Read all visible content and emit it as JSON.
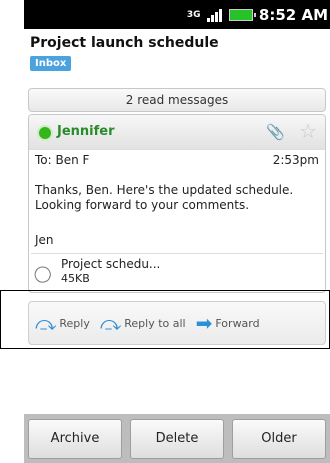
{
  "status": {
    "network": "3G",
    "time": "8:52 AM"
  },
  "subject": {
    "title": "Project launch schedule",
    "folder": "Inbox"
  },
  "thread": {
    "read_summary": "2 read messages"
  },
  "message": {
    "sender": "Jennifer",
    "to": "To: Ben F",
    "time": "2:53pm",
    "body": "Thanks, Ben. Here's the updated schedule. Looking forward to your comments.",
    "signature": "Jen",
    "attachment": {
      "name": "Project schedu...",
      "size": "45KB"
    }
  },
  "actions": {
    "reply": "Reply",
    "reply_all": "Reply to all",
    "forward": "Forward"
  },
  "bottom": {
    "archive": "Archive",
    "delete": "Delete",
    "older": "Older"
  },
  "colors": {
    "sender": "#2a8b2a",
    "presence": "#35b51c",
    "badge": "#4aa3df",
    "action_icon": "#2f8fd6"
  }
}
